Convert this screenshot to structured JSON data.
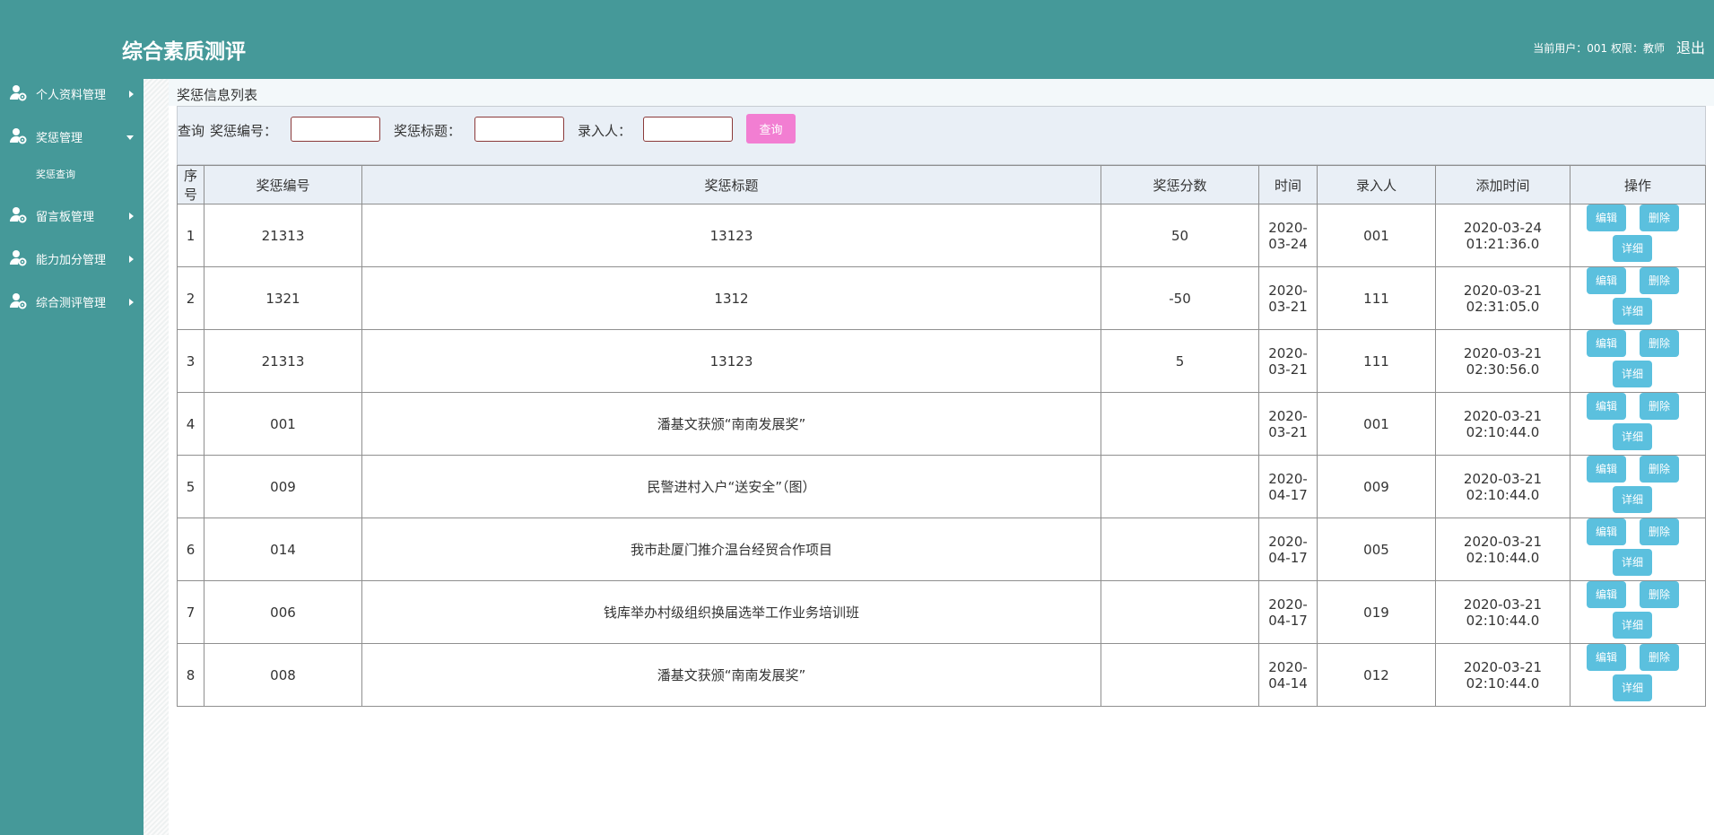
{
  "app": {
    "title": "综合素质测评"
  },
  "header": {
    "user_info": "当前用户：001 权限：教师",
    "logout": "退出"
  },
  "sidebar": {
    "items": [
      {
        "label": "个人资料管理",
        "icon": "user-gear-icon",
        "expanded": false
      },
      {
        "label": "奖惩管理",
        "icon": "user-gear-icon",
        "expanded": true,
        "sub": [
          "奖惩查询"
        ]
      },
      {
        "label": "留言板管理",
        "icon": "user-gear-icon",
        "expanded": false
      },
      {
        "label": "能力加分管理",
        "icon": "user-gear-icon",
        "expanded": false
      },
      {
        "label": "综合测评管理",
        "icon": "user-gear-icon",
        "expanded": false
      }
    ]
  },
  "breadcrumb": "奖惩信息列表",
  "search": {
    "prefix": "查询",
    "field1_label": "奖惩编号：",
    "field1_value": "",
    "field2_label": "奖惩标题：",
    "field2_value": "",
    "field3_label": "录入人：",
    "field3_value": "",
    "button": "查询"
  },
  "table": {
    "headers": [
      "序号",
      "奖惩编号",
      "奖惩标题",
      "奖惩分数",
      "时间",
      "录入人",
      "添加时间",
      "操作"
    ],
    "rows": [
      {
        "no": "1",
        "code": "21313",
        "title": "13123",
        "score": "50",
        "date": "2020-03-24",
        "entrant": "001",
        "added": "2020-03-24 01:21:36.0"
      },
      {
        "no": "2",
        "code": "1321",
        "title": "1312",
        "score": "-50",
        "date": "2020-03-21",
        "entrant": "111",
        "added": "2020-03-21 02:31:05.0"
      },
      {
        "no": "3",
        "code": "21313",
        "title": "13123",
        "score": "5",
        "date": "2020-03-21",
        "entrant": "111",
        "added": "2020-03-21 02:30:56.0"
      },
      {
        "no": "4",
        "code": "001",
        "title": "潘基文获颁“南南发展奖”",
        "score": "",
        "date": "2020-03-21",
        "entrant": "001",
        "added": "2020-03-21 02:10:44.0"
      },
      {
        "no": "5",
        "code": "009",
        "title": "民警进村入户“送安全”（图）",
        "score": "",
        "date": "2020-04-17",
        "entrant": "009",
        "added": "2020-03-21 02:10:44.0"
      },
      {
        "no": "6",
        "code": "014",
        "title": "我市赴厦门推介温台经贸合作项目",
        "score": "",
        "date": "2020-04-17",
        "entrant": "005",
        "added": "2020-03-21 02:10:44.0"
      },
      {
        "no": "7",
        "code": "006",
        "title": "钱库举办村级组织换届选举工作业务培训班",
        "score": "",
        "date": "2020-04-17",
        "entrant": "019",
        "added": "2020-03-21 02:10:44.0"
      },
      {
        "no": "8",
        "code": "008",
        "title": "潘基文获颁“南南发展奖”",
        "score": "",
        "date": "2020-04-14",
        "entrant": "012",
        "added": "2020-03-21 02:10:44.0"
      }
    ],
    "actions": {
      "edit": "编辑",
      "delete": "删除",
      "detail": "详细"
    }
  },
  "colors": {
    "header_bg": "#459999",
    "query_button": "#f27ed2",
    "action_button": "#5bc0de"
  }
}
